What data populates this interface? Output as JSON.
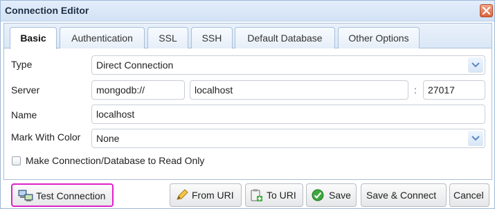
{
  "window": {
    "title": "Connection Editor",
    "close_label": "×"
  },
  "tabs": [
    {
      "label": "Basic",
      "active": true
    },
    {
      "label": "Authentication",
      "active": false
    },
    {
      "label": "SSL",
      "active": false
    },
    {
      "label": "SSH",
      "active": false
    },
    {
      "label": "Default Database",
      "active": false
    },
    {
      "label": "Other Options",
      "active": false
    }
  ],
  "form": {
    "type_label": "Type",
    "type_value": "Direct Connection",
    "server_label": "Server",
    "server_protocol": "mongodb://",
    "server_host": "localhost",
    "server_port_separator": ":",
    "server_port": "27017",
    "name_label": "Name",
    "name_value": "localhost",
    "color_label": "Mark With Color",
    "color_value": "None",
    "readonly_label": "Make Connection/Database to Read Only",
    "readonly_checked": false
  },
  "buttons": {
    "test_connection": "Test Connection",
    "from_uri": "From URI",
    "to_uri": "To URI",
    "save": "Save",
    "save_connect": "Save & Connect",
    "cancel": "Cancel"
  },
  "colors": {
    "highlight": "#e020c8",
    "title_bar": "#d2e2f5",
    "close_button": "#d9643d"
  }
}
